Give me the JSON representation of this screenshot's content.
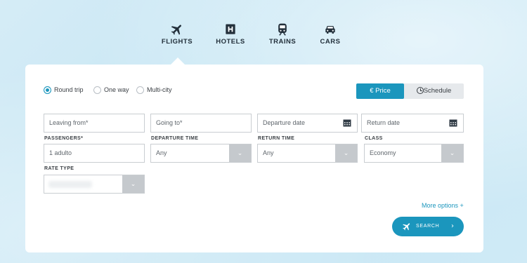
{
  "categories": [
    {
      "label": "FLIGHTS",
      "icon": "plane-icon"
    },
    {
      "label": "HOTELS",
      "icon": "hotel-icon"
    },
    {
      "label": "TRAINS",
      "icon": "train-icon"
    },
    {
      "label": "CARS",
      "icon": "car-icon"
    }
  ],
  "trip_type": {
    "options": [
      "Round trip",
      "One way",
      "Multi-city"
    ],
    "selected": "Round trip"
  },
  "sort_toggle": {
    "price_label": "€ Price",
    "schedule_label": "Schedule",
    "active": "price"
  },
  "fields": {
    "leaving_from": {
      "placeholder": "Leaving from*"
    },
    "going_to": {
      "placeholder": "Going to*"
    },
    "departure_date": {
      "placeholder": "Departure date"
    },
    "return_date": {
      "placeholder": "Return date"
    }
  },
  "selects": {
    "passengers": {
      "label": "PASSENGERS*",
      "value": "1 adulto"
    },
    "departure_time": {
      "label": "DEPARTURE TIME",
      "value": "Any"
    },
    "return_time": {
      "label": "RETURN TIME",
      "value": "Any"
    },
    "class": {
      "label": "CLASS",
      "value": "Economy"
    },
    "rate_type": {
      "label": "RATE TYPE",
      "value": ""
    }
  },
  "more_options": "More options +",
  "search_button": "SEARCH",
  "colors": {
    "accent": "#1b96bd",
    "caret_bg": "#c5c9cd",
    "toggle_bg": "#e6e9ec"
  }
}
